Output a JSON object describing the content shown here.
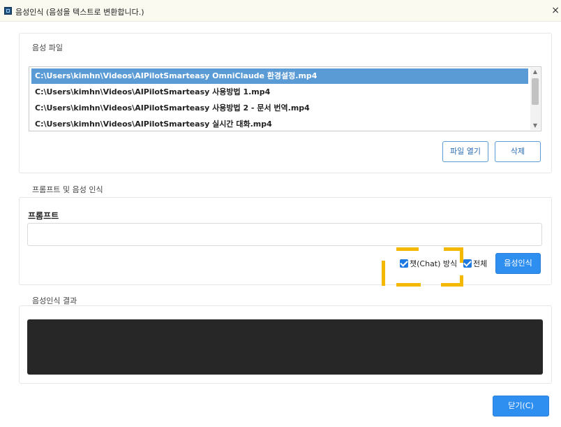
{
  "window": {
    "title": "음성인식 (음성을 텍스트로 변환합니다.)",
    "close_glyph": "×"
  },
  "audio_files": {
    "section_label": "음성 파일",
    "items": [
      {
        "path": "C:\\Users\\kimhn\\Videos\\AIPilotSmarteasy OmniClaude 환경설정.mp4",
        "selected": true
      },
      {
        "path": "C:\\Users\\kimhn\\Videos\\AIPilotSmarteasy 사용방법 1.mp4",
        "selected": false
      },
      {
        "path": "C:\\Users\\kimhn\\Videos\\AIPilotSmarteasy 사용방법 2 - 문서 번역.mp4",
        "selected": false
      },
      {
        "path": "C:\\Users\\kimhn\\Videos\\AIPilotSmarteasy 실시간 대화.mp4",
        "selected": false
      }
    ],
    "open_button": "파일 열기",
    "delete_button": "삭제"
  },
  "prompt_section": {
    "section_label": "프롬프트 및 음성 인식",
    "prompt_label": "프롬프트",
    "prompt_value": "",
    "chat_mode_label": "챗(Chat) 방식",
    "chat_mode_checked": true,
    "all_label": "전체",
    "all_checked": true,
    "recognize_button": "음성인식"
  },
  "result_section": {
    "section_label": "음성인식 결과",
    "result_text": ""
  },
  "footer": {
    "close_button": "닫기(C)"
  },
  "colors": {
    "accent": "#2f8ff0",
    "selection": "#5b9bd5",
    "highlight_dash": "#f5b800",
    "result_bg": "#272727"
  }
}
